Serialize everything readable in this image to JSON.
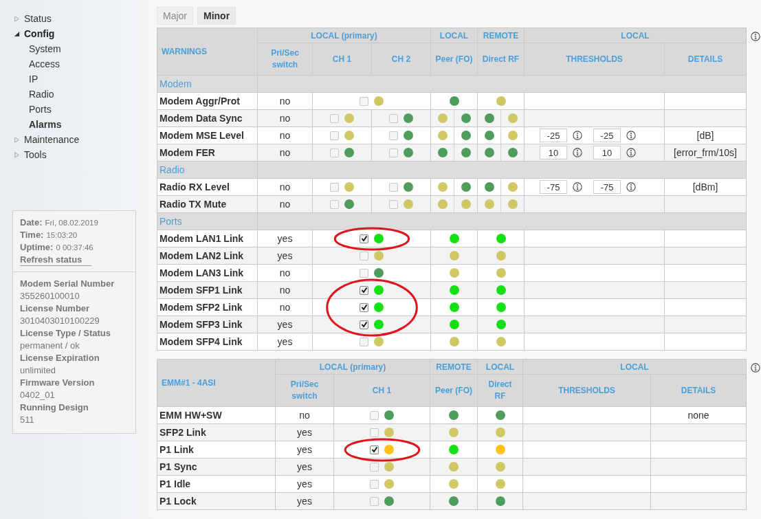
{
  "sidebar": {
    "nav": [
      {
        "label": "Status",
        "expanded": false
      },
      {
        "label": "Config",
        "expanded": true,
        "children": [
          {
            "label": "System",
            "selected": false
          },
          {
            "label": "Access",
            "selected": false
          },
          {
            "label": "IP",
            "selected": false
          },
          {
            "label": "Radio",
            "selected": false
          },
          {
            "label": "Ports",
            "selected": false
          },
          {
            "label": "Alarms",
            "selected": true
          }
        ]
      },
      {
        "label": "Maintenance",
        "expanded": false
      },
      {
        "label": "Tools",
        "expanded": false
      }
    ],
    "status": [
      {
        "label": "Date:",
        "value": "Fri, 08.02.2019"
      },
      {
        "label": "Time:",
        "value": "15:03:20"
      },
      {
        "label": "Uptime:",
        "value": "0 00:37:46"
      }
    ],
    "refresh_link": "Refresh status",
    "device_info": [
      {
        "label": "Modem Serial Number",
        "value": "355260100010"
      },
      {
        "label": "License Number",
        "value": "3010403010100229"
      },
      {
        "label": "License Type / Status",
        "value": "permanent / ok"
      },
      {
        "label": "License Expiration",
        "value": "unlimited"
      },
      {
        "label": "Firmware Version",
        "value": "0402_01"
      },
      {
        "label": "Running Design",
        "value": "511"
      }
    ]
  },
  "tabs": [
    {
      "label": "Major",
      "selected": false
    },
    {
      "label": "Minor",
      "selected": true
    }
  ],
  "tables": [
    {
      "title": "WARNINGS",
      "groups": [
        {
          "label": "LOCAL (primary)",
          "columns": [
            {
              "label": "Pri/Sec switch",
              "kind": "switch"
            },
            {
              "label": "CH 1",
              "kind": "channel"
            },
            {
              "label": "CH 2",
              "kind": "channel"
            }
          ]
        },
        {
          "label": "LOCAL",
          "columns": [
            {
              "label": "Peer (FO)",
              "kind": "peer"
            }
          ]
        },
        {
          "label": "REMOTE",
          "columns": [
            {
              "label": "Direct RF",
              "kind": "direct"
            }
          ]
        },
        {
          "label": "LOCAL",
          "columns": [
            {
              "label": "THRESHOLDS",
              "kind": "thresholds"
            },
            {
              "label": "DETAILS",
              "kind": "details"
            }
          ]
        }
      ],
      "sections": [
        {
          "title": "Modem",
          "rows": [
            {
              "name": "Modem Aggr/Prot",
              "switch": "no",
              "channels": [
                {
                  "checked": false,
                  "color": "#cfc865"
                }
              ],
              "peer": [
                {
                  "color": "#4f9d5c"
                }
              ],
              "direct": [
                {
                  "color": "#cfc865"
                }
              ]
            },
            {
              "name": "Modem Data Sync",
              "switch": "no",
              "channels": [
                {
                  "checked": false,
                  "color": "#cfc865"
                },
                {
                  "checked": false,
                  "color": "#4f9d5c"
                }
              ],
              "peer": [
                {
                  "color": "#cfc865"
                },
                {
                  "color": "#4f9d5c"
                }
              ],
              "direct": [
                {
                  "color": "#4f9d5c"
                },
                {
                  "color": "#cfc865"
                }
              ]
            },
            {
              "name": "Modem MSE Level",
              "switch": "no",
              "channels": [
                {
                  "checked": false,
                  "color": "#cfc865"
                },
                {
                  "checked": false,
                  "color": "#4f9d5c"
                }
              ],
              "peer": [
                {
                  "color": "#cfc865"
                },
                {
                  "color": "#4f9d5c"
                }
              ],
              "direct": [
                {
                  "color": "#4f9d5c"
                },
                {
                  "color": "#cfc865"
                }
              ],
              "thresholds": [
                "-25",
                "-25"
              ],
              "details": "[dB]"
            },
            {
              "name": "Modem FER",
              "switch": "no",
              "channels": [
                {
                  "checked": false,
                  "color": "#4f9d5c"
                },
                {
                  "checked": false,
                  "color": "#4f9d5c"
                }
              ],
              "peer": [
                {
                  "color": "#4f9d5c"
                },
                {
                  "color": "#4f9d5c"
                }
              ],
              "direct": [
                {
                  "color": "#4f9d5c"
                },
                {
                  "color": "#4f9d5c"
                }
              ],
              "thresholds": [
                "10",
                "10"
              ],
              "details": "[error_frm/10s]"
            }
          ]
        },
        {
          "title": "Radio",
          "rows": [
            {
              "name": "Radio RX Level",
              "switch": "no",
              "channels": [
                {
                  "checked": false,
                  "color": "#cfc865"
                },
                {
                  "checked": false,
                  "color": "#4f9d5c"
                }
              ],
              "peer": [
                {
                  "color": "#cfc865"
                },
                {
                  "color": "#4f9d5c"
                }
              ],
              "direct": [
                {
                  "color": "#4f9d5c"
                },
                {
                  "color": "#cfc865"
                }
              ],
              "thresholds": [
                "-75",
                "-75"
              ],
              "details": "[dBm]"
            },
            {
              "name": "Radio TX Mute",
              "switch": "no",
              "channels": [
                {
                  "checked": false,
                  "color": "#4f9d5c"
                },
                {
                  "checked": false,
                  "color": "#cfc865"
                }
              ],
              "peer": [
                {
                  "color": "#cfc865"
                },
                {
                  "color": "#cfc865"
                }
              ],
              "direct": [
                {
                  "color": "#cfc865"
                },
                {
                  "color": "#cfc865"
                }
              ]
            }
          ]
        },
        {
          "title": "Ports",
          "rows": [
            {
              "name": "Modem LAN1 Link",
              "switch": "yes",
              "circled": true,
              "channels": [
                {
                  "checked": true,
                  "color": "#14e014"
                }
              ],
              "peer": [
                {
                  "color": "#14e014"
                }
              ],
              "direct": [
                {
                  "color": "#14e014"
                }
              ]
            },
            {
              "name": "Modem LAN2 Link",
              "switch": "yes",
              "circled": false,
              "channels": [
                {
                  "checked": false,
                  "color": "#cfc865"
                }
              ],
              "peer": [
                {
                  "color": "#cfc865"
                }
              ],
              "direct": [
                {
                  "color": "#cfc865"
                }
              ]
            },
            {
              "name": "Modem LAN3 Link",
              "switch": "no",
              "circled": false,
              "channels": [
                {
                  "checked": false,
                  "color": "#4f9d5c"
                }
              ],
              "peer": [
                {
                  "color": "#cfc865"
                }
              ],
              "direct": [
                {
                  "color": "#cfc865"
                }
              ]
            },
            {
              "name": "Modem SFP1 Link",
              "switch": "no",
              "circled": true,
              "channels": [
                {
                  "checked": true,
                  "color": "#14e014"
                }
              ],
              "peer": [
                {
                  "color": "#14e014"
                }
              ],
              "direct": [
                {
                  "color": "#14e014"
                }
              ]
            },
            {
              "name": "Modem SFP2 Link",
              "switch": "no",
              "circled": true,
              "channels": [
                {
                  "checked": true,
                  "color": "#14e014"
                }
              ],
              "peer": [
                {
                  "color": "#14e014"
                }
              ],
              "direct": [
                {
                  "color": "#14e014"
                }
              ]
            },
            {
              "name": "Modem SFP3 Link",
              "switch": "yes",
              "circled": true,
              "channels": [
                {
                  "checked": true,
                  "color": "#14e014"
                }
              ],
              "peer": [
                {
                  "color": "#14e014"
                }
              ],
              "direct": [
                {
                  "color": "#14e014"
                }
              ]
            },
            {
              "name": "Modem SFP4 Link",
              "switch": "yes",
              "circled": false,
              "channels": [
                {
                  "checked": false,
                  "color": "#cfc865"
                }
              ],
              "peer": [
                {
                  "color": "#cfc865"
                }
              ],
              "direct": [
                {
                  "color": "#cfc865"
                }
              ]
            }
          ]
        }
      ]
    },
    {
      "title": "EMM#1 - 4ASI",
      "groups": [
        {
          "label": "LOCAL (primary)",
          "columns": [
            {
              "label": "Pri/Sec switch",
              "kind": "switch"
            },
            {
              "label": "CH 1",
              "kind": "channel"
            }
          ]
        },
        {
          "label": "REMOTE",
          "columns": [
            {
              "label": "Peer (FO)",
              "kind": "peer"
            }
          ]
        },
        {
          "label": "LOCAL",
          "columns": [
            {
              "label": "Direct RF",
              "kind": "direct"
            }
          ]
        },
        {
          "label": "LOCAL",
          "columns": [
            {
              "label": "THRESHOLDS",
              "kind": "thresholds"
            },
            {
              "label": "DETAILS",
              "kind": "details"
            }
          ]
        }
      ],
      "sections": [
        {
          "rows": [
            {
              "name": "EMM HW+SW",
              "switch": "no",
              "circled": false,
              "channels": [
                {
                  "checked": false,
                  "color": "#4f9d5c"
                }
              ],
              "peer": [
                {
                  "color": "#4f9d5c"
                }
              ],
              "direct": [
                {
                  "color": "#4f9d5c"
                }
              ],
              "details": "none"
            },
            {
              "name": "SFP2 Link",
              "switch": "yes",
              "circled": false,
              "channels": [
                {
                  "checked": false,
                  "color": "#cfc865"
                }
              ],
              "peer": [
                {
                  "color": "#cfc865"
                }
              ],
              "direct": [
                {
                  "color": "#cfc865"
                }
              ]
            },
            {
              "name": "P1 Link",
              "switch": "yes",
              "circled": true,
              "channels": [
                {
                  "checked": true,
                  "color": "#ffc21a"
                }
              ],
              "peer": [
                {
                  "color": "#14e014"
                }
              ],
              "direct": [
                {
                  "color": "#ffc21a"
                }
              ]
            },
            {
              "name": "P1 Sync",
              "switch": "yes",
              "circled": false,
              "channels": [
                {
                  "checked": false,
                  "color": "#cfc865"
                }
              ],
              "peer": [
                {
                  "color": "#cfc865"
                }
              ],
              "direct": [
                {
                  "color": "#cfc865"
                }
              ]
            },
            {
              "name": "P1 Idle",
              "switch": "yes",
              "circled": false,
              "channels": [
                {
                  "checked": false,
                  "color": "#cfc865"
                }
              ],
              "peer": [
                {
                  "color": "#cfc865"
                }
              ],
              "direct": [
                {
                  "color": "#cfc865"
                }
              ]
            },
            {
              "name": "P1 Lock",
              "switch": "yes",
              "circled": false,
              "channels": [
                {
                  "checked": false,
                  "color": "#4f9d5c"
                }
              ],
              "peer": [
                {
                  "color": "#4f9d5c"
                }
              ],
              "direct": [
                {
                  "color": "#4f9d5c"
                }
              ]
            }
          ]
        }
      ]
    }
  ]
}
